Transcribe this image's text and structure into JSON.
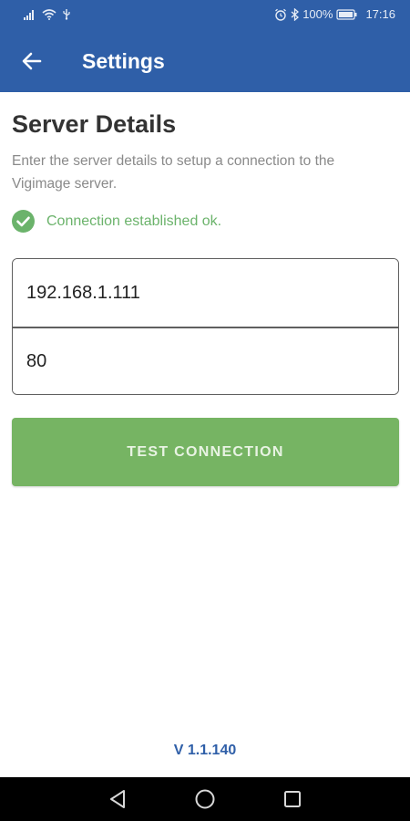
{
  "status_bar": {
    "battery_percent": "100%",
    "time": "17:16",
    "icons": [
      "signal-icon",
      "wifi-icon",
      "usb-icon",
      "alarm-icon",
      "bluetooth-icon",
      "battery-icon"
    ]
  },
  "app_bar": {
    "title": "Settings",
    "back_icon": "arrow-left-icon"
  },
  "main": {
    "heading": "Server Details",
    "description": "Enter the server details to setup a connection to the Vigimage server.",
    "status": {
      "icon": "check-circle-icon",
      "text": "Connection established ok."
    },
    "server_address": {
      "value": "192.168.1.111",
      "placeholder": ""
    },
    "port": {
      "value": "80",
      "placeholder": ""
    },
    "test_button_label": "TEST CONNECTION"
  },
  "footer": {
    "version": "V 1.1.140"
  },
  "nav_bar": {
    "back": "nav-back-icon",
    "home": "nav-home-icon",
    "recents": "nav-recents-icon"
  },
  "colors": {
    "primary": "#2f5fa8",
    "success": "#6bb36b",
    "button": "#76b463",
    "text_dark": "#333333",
    "text_muted": "#8a8a8a"
  }
}
